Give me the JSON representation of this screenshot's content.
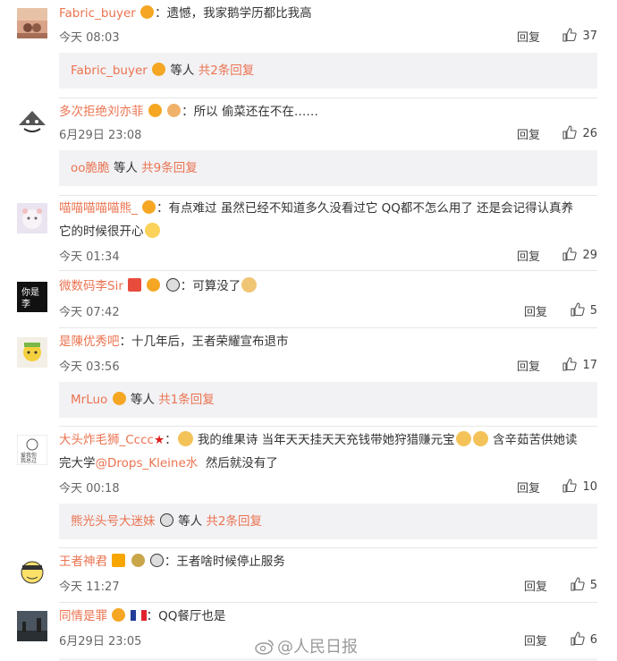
{
  "actions": {
    "reply": "回复",
    "others": "等人",
    "total_prefix": "共",
    "total_suffix": "条回复"
  },
  "comments": [
    {
      "user": "Fabric_buyer",
      "sep": "：",
      "text": "遗憾，我家鹅学历都比我高",
      "time": "今天 08:03",
      "likes": "37",
      "sub": {
        "user": "Fabric_buyer",
        "count": "2"
      }
    },
    {
      "user": "多次拒绝刘亦菲",
      "sep": "：",
      "text": "所以 偷菜还在不在……",
      "time": "6月29日 23:08",
      "likes": "26",
      "sub": {
        "user": "oo脆脆",
        "count": "9"
      }
    },
    {
      "user": "喵喵喵喵喵熊_",
      "sep": "：",
      "text": "有点难过 虽然已经不知道多久没看过它 QQ都不怎么用了 还是会记得认真养",
      "text2": "它的时候很开心",
      "time": "今天 01:34",
      "likes": "29"
    },
    {
      "user": "微数码李Sir",
      "sep": "：",
      "text": "可算没了",
      "time": "今天 07:42",
      "likes": "5"
    },
    {
      "user": "是陳优秀吧",
      "sep": "：",
      "text": "十几年后，王者荣耀宣布退市",
      "time": "今天 03:56",
      "likes": "17",
      "sub": {
        "user": "MrLuo",
        "count": "1"
      }
    },
    {
      "user": "大头炸毛狮_Cccc",
      "sep": "：",
      "text_a": "我的维果诗 当年天天挂天天充钱带她狩猎赚元宝",
      "text_b": "含辛茹苦供她读",
      "text2_a": "完大学",
      "mention": "@Drops_Kleine水",
      "text2_b": "  然后就没有了",
      "time": "今天 00:18",
      "likes": "10",
      "sub": {
        "user": "熊光头号大迷妹",
        "count": "2"
      }
    },
    {
      "user": "王者神君",
      "sep": "：",
      "text": "王者啥时候停止服务",
      "time": "今天 11:27",
      "likes": "5"
    },
    {
      "user": "同情是罪",
      "sep": "：",
      "text": "QQ餐厅也是",
      "time": "6月29日 23:05",
      "likes": "6"
    }
  ],
  "watermark": "@人民日报",
  "colors": {
    "username": "#eb7350",
    "mention": "#eb7350",
    "sub_bg": "#f2f2f5",
    "vip_badge": "#f5a623",
    "verified": "#f7a600"
  },
  "icons": {
    "like": "thumbs-up-icon",
    "vip": "crown-vip-icon",
    "weibo": "weibo-logo-icon"
  }
}
